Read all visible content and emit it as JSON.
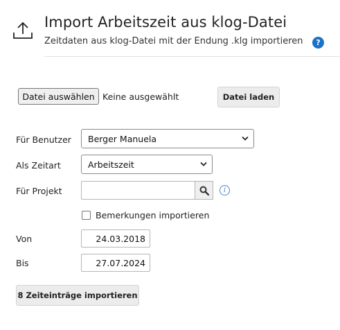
{
  "header": {
    "title": "Import Arbeitszeit aus klog-Datei",
    "subtitle": "Zeitdaten aus klog-Datei mit der Endung .klg importieren",
    "help_icon": "?"
  },
  "file": {
    "choose_label": "Datei auswählen",
    "status": "Keine ausgewählt",
    "load_label": "Datei laden"
  },
  "form": {
    "user_label": "Für Benutzer",
    "user_value": "Berger Manuela",
    "type_label": "Als Zeitart",
    "type_value": "Arbeitszeit",
    "project_label": "Für Projekt",
    "project_value": "",
    "remarks_label": "Bemerkungen importieren",
    "remarks_checked": false,
    "from_label": "Von",
    "from_value": "24.03.2018",
    "to_label": "Bis",
    "to_value": "27.07.2024"
  },
  "actions": {
    "import_label": "8 Zeiteinträge importieren"
  },
  "icons": {
    "upload": "upload-icon",
    "help": "help-icon",
    "search": "search-icon",
    "info": "info-icon",
    "chevron": "chevron-down-icon"
  },
  "colors": {
    "help_blue": "#1a73c8",
    "info_blue": "#4a86c8",
    "button_bg": "#ececec"
  }
}
